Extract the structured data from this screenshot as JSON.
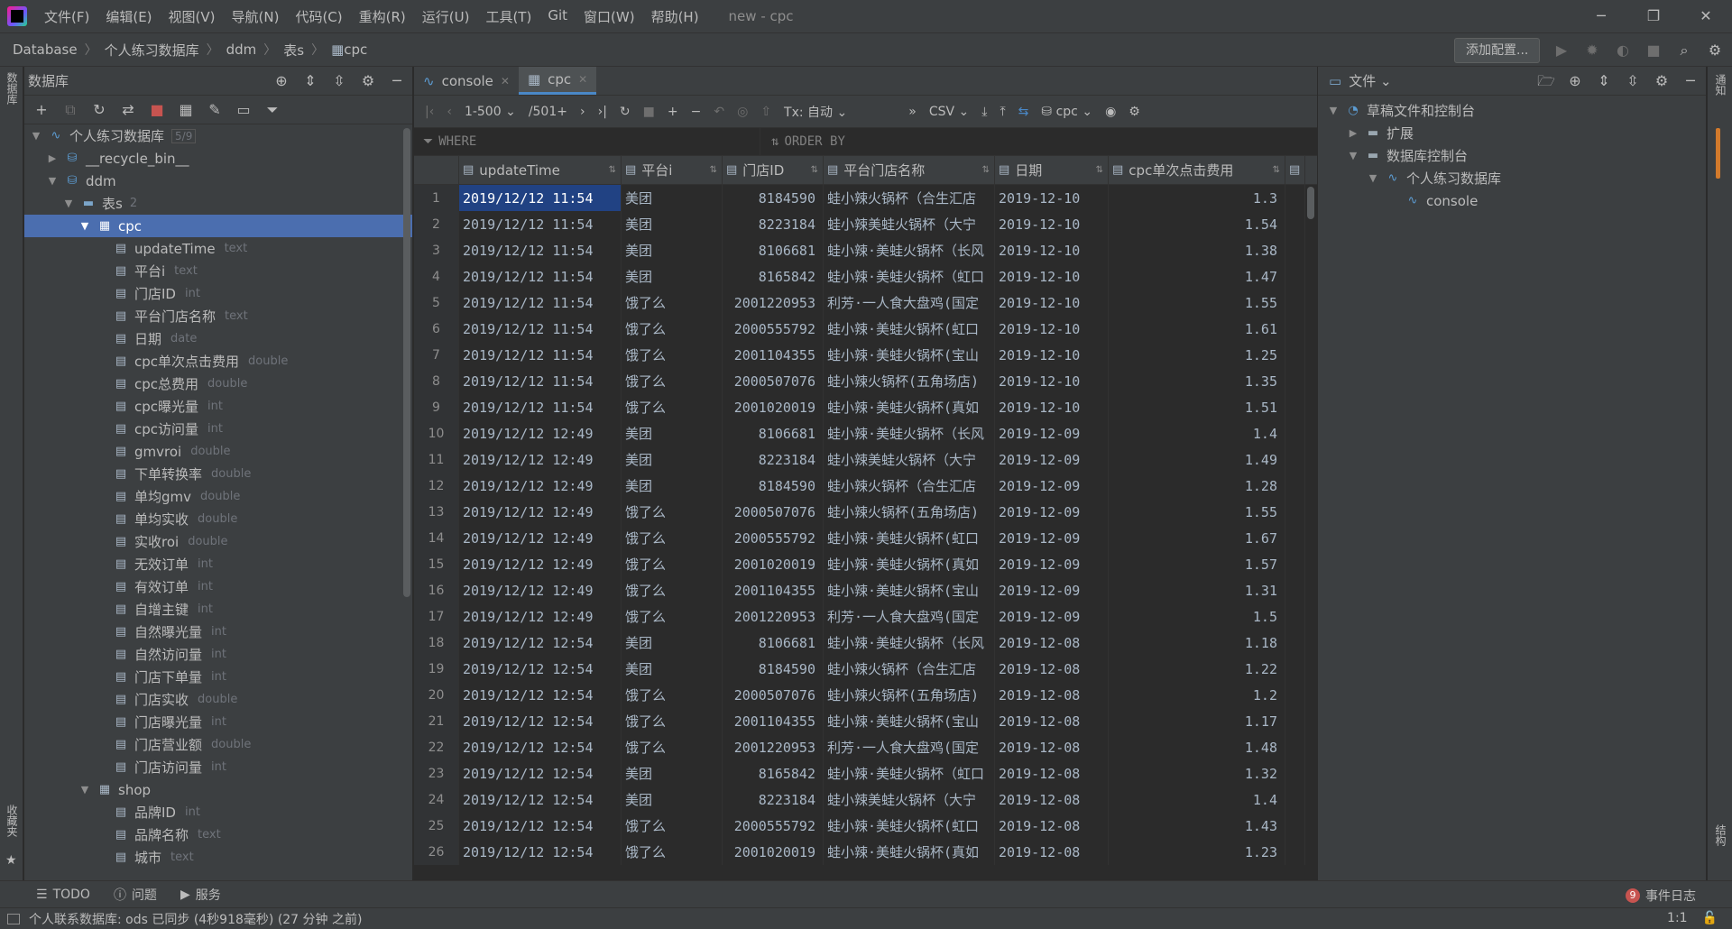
{
  "menubar": {
    "items": [
      "文件(F)",
      "编辑(E)",
      "视图(V)",
      "导航(N)",
      "代码(C)",
      "重构(R)",
      "运行(U)",
      "工具(T)",
      "Git",
      "窗口(W)",
      "帮助(H)"
    ],
    "title": "new - cpc"
  },
  "navbar": {
    "crumbs": [
      "Database",
      "个人练习数据库",
      "ddm",
      "表s",
      "cpc"
    ],
    "add_config": "添加配置..."
  },
  "left_strip": {
    "top_tab": "数据库",
    "bottom_tab": "收藏夹"
  },
  "right_strip": {
    "top_tab": "通知",
    "bottom_tab": "结构"
  },
  "db_panel": {
    "title": "数据库",
    "root": {
      "label": "个人练习数据库",
      "badge": "5/9"
    },
    "recycle": "__recycle_bin__",
    "schema": "ddm",
    "tables_folder": {
      "label": "表s",
      "count": "2"
    },
    "table_cpc": "cpc",
    "cpc_columns": [
      {
        "name": "updateTime",
        "type": "text"
      },
      {
        "name": "平台i",
        "type": "text"
      },
      {
        "name": "门店ID",
        "type": "int"
      },
      {
        "name": "平台门店名称",
        "type": "text"
      },
      {
        "name": "日期",
        "type": "date"
      },
      {
        "name": "cpc单次点击费用",
        "type": "double"
      },
      {
        "name": "cpc总费用",
        "type": "double"
      },
      {
        "name": "cpc曝光量",
        "type": "int"
      },
      {
        "name": "cpc访问量",
        "type": "int"
      },
      {
        "name": "gmvroi",
        "type": "double"
      },
      {
        "name": "下单转换率",
        "type": "double"
      },
      {
        "name": "单均gmv",
        "type": "double"
      },
      {
        "name": "单均实收",
        "type": "double"
      },
      {
        "name": "实收roi",
        "type": "double"
      },
      {
        "name": "无效订单",
        "type": "int"
      },
      {
        "name": "有效订单",
        "type": "int"
      },
      {
        "name": "自增主键",
        "type": "int"
      },
      {
        "name": "自然曝光量",
        "type": "int"
      },
      {
        "name": "自然访问量",
        "type": "int"
      },
      {
        "name": "门店下单量",
        "type": "int"
      },
      {
        "name": "门店实收",
        "type": "double"
      },
      {
        "name": "门店曝光量",
        "type": "int"
      },
      {
        "name": "门店营业额",
        "type": "double"
      },
      {
        "name": "门店访问量",
        "type": "int"
      }
    ],
    "table_shop": "shop",
    "shop_columns": [
      {
        "name": "品牌ID",
        "type": "int"
      },
      {
        "name": "品牌名称",
        "type": "text"
      },
      {
        "name": "城市",
        "type": "text"
      }
    ]
  },
  "editor": {
    "tabs": [
      {
        "label": "console",
        "active": false
      },
      {
        "label": "cpc",
        "active": true
      }
    ],
    "toolbar": {
      "range": "1-500",
      "total": "/501+",
      "tx": "Tx: 自动",
      "export_format": "CSV",
      "schema_select": "cpc"
    },
    "filter": {
      "where": "WHERE",
      "order_by": "ORDER BY"
    },
    "columns": [
      "updateTime",
      "平台i",
      "门店ID",
      "平台门店名称",
      "日期",
      "cpc单次点击费用"
    ],
    "rows": [
      [
        "1",
        "2019/12/12 11:54",
        "美团",
        "8184590",
        "蛙小辣火锅杯（合生汇店",
        "2019-12-10",
        "1.3"
      ],
      [
        "2",
        "2019/12/12 11:54",
        "美团",
        "8223184",
        "蛙小辣美蛙火锅杯（大宁",
        "2019-12-10",
        "1.54"
      ],
      [
        "3",
        "2019/12/12 11:54",
        "美团",
        "8106681",
        "蛙小辣·美蛙火锅杯（长风",
        "2019-12-10",
        "1.38"
      ],
      [
        "4",
        "2019/12/12 11:54",
        "美团",
        "8165842",
        "蛙小辣·美蛙火锅杯（虹口",
        "2019-12-10",
        "1.47"
      ],
      [
        "5",
        "2019/12/12 11:54",
        "饿了么",
        "2001220953",
        "利芳·一人食大盘鸡(国定",
        "2019-12-10",
        "1.55"
      ],
      [
        "6",
        "2019/12/12 11:54",
        "饿了么",
        "2000555792",
        "蛙小辣·美蛙火锅杯(虹口",
        "2019-12-10",
        "1.61"
      ],
      [
        "7",
        "2019/12/12 11:54",
        "饿了么",
        "2001104355",
        "蛙小辣·美蛙火锅杯(宝山",
        "2019-12-10",
        "1.25"
      ],
      [
        "8",
        "2019/12/12 11:54",
        "饿了么",
        "2000507076",
        "蛙小辣火锅杯(五角场店)",
        "2019-12-10",
        "1.35"
      ],
      [
        "9",
        "2019/12/12 11:54",
        "饿了么",
        "2001020019",
        "蛙小辣·美蛙火锅杯(真如",
        "2019-12-10",
        "1.51"
      ],
      [
        "10",
        "2019/12/12 12:49",
        "美团",
        "8106681",
        "蛙小辣·美蛙火锅杯（长风",
        "2019-12-09",
        "1.4"
      ],
      [
        "11",
        "2019/12/12 12:49",
        "美团",
        "8223184",
        "蛙小辣美蛙火锅杯（大宁",
        "2019-12-09",
        "1.49"
      ],
      [
        "12",
        "2019/12/12 12:49",
        "美团",
        "8184590",
        "蛙小辣火锅杯（合生汇店",
        "2019-12-09",
        "1.28"
      ],
      [
        "13",
        "2019/12/12 12:49",
        "饿了么",
        "2000507076",
        "蛙小辣火锅杯(五角场店)",
        "2019-12-09",
        "1.55"
      ],
      [
        "14",
        "2019/12/12 12:49",
        "饿了么",
        "2000555792",
        "蛙小辣·美蛙火锅杯(虹口",
        "2019-12-09",
        "1.67"
      ],
      [
        "15",
        "2019/12/12 12:49",
        "饿了么",
        "2001020019",
        "蛙小辣·美蛙火锅杯(真如",
        "2019-12-09",
        "1.57"
      ],
      [
        "16",
        "2019/12/12 12:49",
        "饿了么",
        "2001104355",
        "蛙小辣·美蛙火锅杯(宝山",
        "2019-12-09",
        "1.31"
      ],
      [
        "17",
        "2019/12/12 12:49",
        "饿了么",
        "2001220953",
        "利芳·一人食大盘鸡(国定",
        "2019-12-09",
        "1.5"
      ],
      [
        "18",
        "2019/12/12 12:54",
        "美团",
        "8106681",
        "蛙小辣·美蛙火锅杯（长风",
        "2019-12-08",
        "1.18"
      ],
      [
        "19",
        "2019/12/12 12:54",
        "美团",
        "8184590",
        "蛙小辣火锅杯（合生汇店",
        "2019-12-08",
        "1.22"
      ],
      [
        "20",
        "2019/12/12 12:54",
        "饿了么",
        "2000507076",
        "蛙小辣火锅杯(五角场店)",
        "2019-12-08",
        "1.2"
      ],
      [
        "21",
        "2019/12/12 12:54",
        "饿了么",
        "2001104355",
        "蛙小辣·美蛙火锅杯(宝山",
        "2019-12-08",
        "1.17"
      ],
      [
        "22",
        "2019/12/12 12:54",
        "饿了么",
        "2001220953",
        "利芳·一人食大盘鸡(国定",
        "2019-12-08",
        "1.48"
      ],
      [
        "23",
        "2019/12/12 12:54",
        "美团",
        "8165842",
        "蛙小辣·美蛙火锅杯（虹口",
        "2019-12-08",
        "1.32"
      ],
      [
        "24",
        "2019/12/12 12:54",
        "美团",
        "8223184",
        "蛙小辣美蛙火锅杯（大宁",
        "2019-12-08",
        "1.4"
      ],
      [
        "25",
        "2019/12/12 12:54",
        "饿了么",
        "2000555792",
        "蛙小辣·美蛙火锅杯(虹口",
        "2019-12-08",
        "1.43"
      ],
      [
        "26",
        "2019/12/12 12:54",
        "饿了么",
        "2001020019",
        "蛙小辣·美蛙火锅杯(真如",
        "2019-12-08",
        "1.23"
      ]
    ]
  },
  "files_panel": {
    "title": "文件",
    "items": [
      {
        "label": "草稿文件和控制台",
        "indent": 0,
        "arrow": "down",
        "icon": "scratch-icon"
      },
      {
        "label": "扩展",
        "indent": 1,
        "arrow": "right",
        "icon": "folder-icon"
      },
      {
        "label": "数据库控制台",
        "indent": 1,
        "arrow": "down",
        "icon": "folder-icon"
      },
      {
        "label": "个人练习数据库",
        "indent": 2,
        "arrow": "down",
        "icon": "datasource-icon"
      },
      {
        "label": "console",
        "indent": 3,
        "arrow": "none",
        "icon": "console-icon"
      }
    ]
  },
  "bottom_tools": {
    "todo": "TODO",
    "problems": "问题",
    "services": "服务",
    "event_log": "事件日志",
    "event_count": "9"
  },
  "status": {
    "message": "个人联系数据库: ods 已同步 (4秒918毫秒) (27 分钟 之前)",
    "position": "1:1"
  },
  "colors": {
    "accent": "#4b6eaf",
    "selection": "#214283",
    "bg": "#2b2b2b",
    "panel": "#3c3f41",
    "error": "#c75450"
  }
}
